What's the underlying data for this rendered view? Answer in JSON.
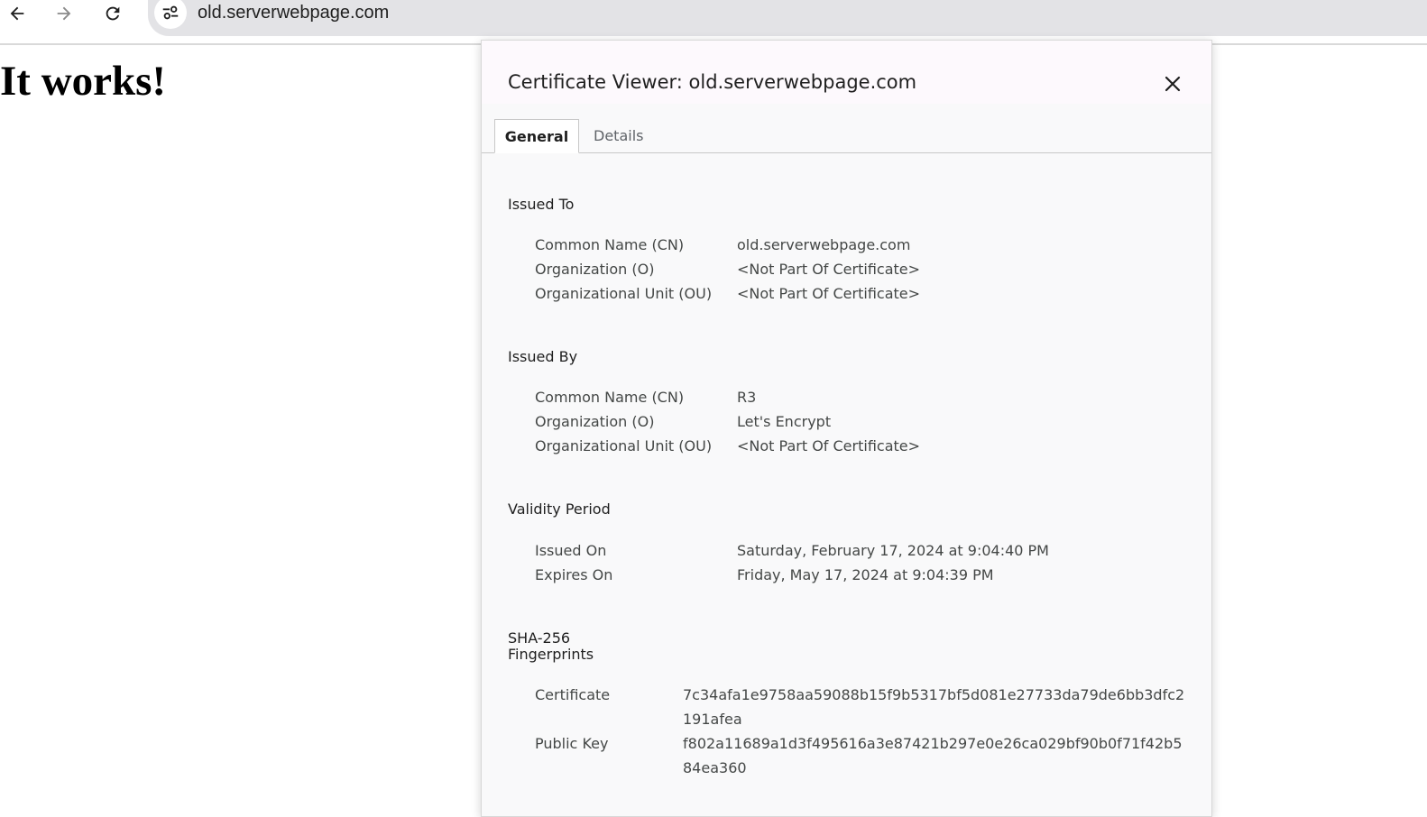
{
  "browser": {
    "url": "old.serverwebpage.com",
    "icons": {
      "back": "arrow-back-icon",
      "forward": "arrow-forward-icon",
      "reload": "reload-icon",
      "site_info": "tune-icon"
    }
  },
  "page": {
    "heading": "It works!"
  },
  "dialog": {
    "title": "Certificate Viewer: old.serverwebpage.com",
    "tabs": [
      {
        "label": "General",
        "selected": true
      },
      {
        "label": "Details",
        "selected": false
      }
    ],
    "issued_to": {
      "title": "Issued To",
      "rows": [
        {
          "label": "Common Name (CN)",
          "value": "old.serverwebpage.com"
        },
        {
          "label": "Organization (O)",
          "value": "<Not Part Of Certificate>"
        },
        {
          "label": "Organizational Unit (OU)",
          "value": "<Not Part Of Certificate>"
        }
      ]
    },
    "issued_by": {
      "title": "Issued By",
      "rows": [
        {
          "label": "Common Name (CN)",
          "value": "R3"
        },
        {
          "label": "Organization (O)",
          "value": "Let's Encrypt"
        },
        {
          "label": "Organizational Unit (OU)",
          "value": "<Not Part Of Certificate>"
        }
      ]
    },
    "validity": {
      "title": "Validity Period",
      "rows": [
        {
          "label": "Issued On",
          "value": "Saturday, February 17, 2024 at 9:04:40 PM"
        },
        {
          "label": "Expires On",
          "value": "Friday, May 17, 2024 at 9:04:39 PM"
        }
      ]
    },
    "fingerprints": {
      "title_line1": "SHA-256",
      "title_line2": "Fingerprints",
      "rows": [
        {
          "label": "Certificate",
          "value": "7c34afa1e9758aa59088b15f9b5317bf5d081e27733da79de6bb3dfc2191afea"
        },
        {
          "label": "Public Key",
          "value": "f802a11689a1d3f495616a3e87421b297e0e26ca029bf90b0f71f42b584ea360"
        }
      ]
    }
  },
  "colors": {
    "accent_text": "#1f1f1f",
    "secondary_text": "#444746",
    "dialog_bg": "#f9f9fa",
    "omnibox_bg": "#e3e3e6"
  }
}
